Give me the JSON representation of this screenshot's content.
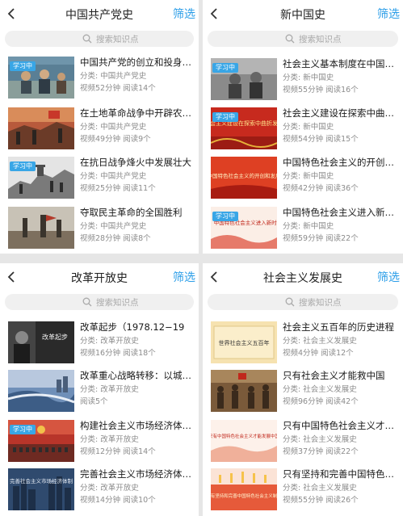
{
  "search_icon": "search-icon",
  "back_icon": "chevron-left-icon",
  "badge_color": "#39a6e6",
  "filter_color": "#2a9de8",
  "panels": [
    {
      "title": "中国共产党史",
      "filter": "筛选",
      "search_placeholder": "搜索知识点",
      "items": [
        {
          "title": "中国共产党的创立和投身大...",
          "category": "分类: 中国共产党史",
          "stats": "视频52分钟 阅读14个",
          "badge": "学习中"
        },
        {
          "title": "在土地革命战争中开辟农村...",
          "category": "分类: 中国共产党史",
          "stats": "视频49分钟 阅读9个",
          "badge": ""
        },
        {
          "title": "在抗日战争烽火中发展壮大",
          "category": "分类: 中国共产党史",
          "stats": "视频25分钟 阅读11个",
          "badge": "学习中"
        },
        {
          "title": "夺取民主革命的全国胜利",
          "category": "分类: 中国共产党史",
          "stats": "视频28分钟 阅读8个",
          "badge": ""
        }
      ]
    },
    {
      "title": "新中国史",
      "filter": "筛选",
      "search_placeholder": "搜索知识点",
      "items": [
        {
          "title": "社会主义基本制度在中国的...",
          "category": "分类: 新中国史",
          "stats": "视频55分钟 阅读16个",
          "badge": "学习中"
        },
        {
          "title": "社会主义建设在探索中曲折...",
          "category": "分类: 新中国史",
          "stats": "视频54分钟 阅读15个",
          "badge": "学习中"
        },
        {
          "title": "中国特色社会主义的开创和...",
          "category": "分类: 新中国史",
          "stats": "视频42分钟 阅读36个",
          "badge": ""
        },
        {
          "title": "中国特色社会主义进入新时...",
          "category": "分类: 新中国史",
          "stats": "视频59分钟 阅读22个",
          "badge": "学习中"
        }
      ]
    },
    {
      "title": "改革开放史",
      "filter": "筛选",
      "search_placeholder": "搜索知识点",
      "items": [
        {
          "title": "改革起步（1978.12−19",
          "category": "分类: 改革开放史",
          "stats": "视频16分钟 阅读18个",
          "badge": ""
        },
        {
          "title": "改革重心战略转移：以城市...",
          "category": "分类: 改革开放史",
          "stats": "阅读5个",
          "badge": ""
        },
        {
          "title": "构建社会主义市场经济体制...",
          "category": "分类: 改革开放史",
          "stats": "视频12分钟 阅读14个",
          "badge": "学习中"
        },
        {
          "title": "完善社会主义市场经济体制...",
          "category": "分类: 改革开放史",
          "stats": "视频14分钟 阅读10个",
          "badge": ""
        }
      ]
    },
    {
      "title": "社会主义发展史",
      "filter": "筛选",
      "search_placeholder": "搜索知识点",
      "items": [
        {
          "title": "社会主义五百年的历史进程",
          "category": "分类: 社会主义发展史",
          "stats": "视频4分钟 阅读12个",
          "badge": ""
        },
        {
          "title": "只有社会主义才能救中国",
          "category": "分类: 社会主义发展史",
          "stats": "视频96分钟 阅读42个",
          "badge": ""
        },
        {
          "title": "只有中国特色社会主义才能...",
          "category": "分类: 社会主义发展史",
          "stats": "视频37分钟 阅读22个",
          "badge": ""
        },
        {
          "title": "只有坚持和完善中国特色社...",
          "category": "分类: 社会主义发展史",
          "stats": "视频55分钟 阅读26个",
          "badge": ""
        }
      ]
    }
  ],
  "thumb_texts": {
    "p0_1": "",
    "p1_1": "社会主义建设在探索中曲折发展",
    "p1_2": "中国特色社会主义的开创和发展",
    "p1_3": "中国特色社会主义进入新时代",
    "p2_0": "改革起步",
    "p2_3": "完善社会主义市场经济体制",
    "p3_0": "世界社会主义五百年",
    "p3_2": "只有中国特色社会主义才能发展中国",
    "p3_3": "只有坚持和完善中国特色社会主义制度"
  }
}
